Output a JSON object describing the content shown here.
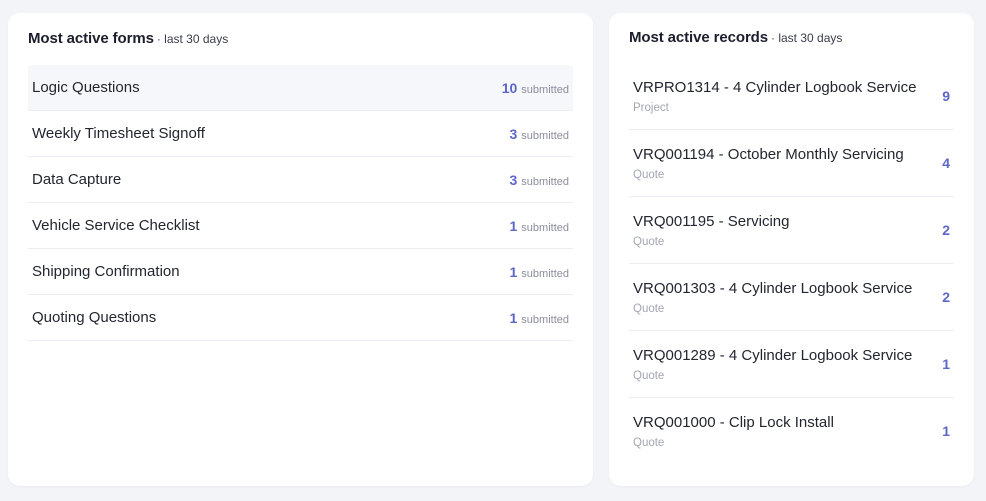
{
  "forms_card": {
    "title": "Most active forms",
    "subtitle": "· last 30 days",
    "submitted_label": "submitted",
    "items": [
      {
        "name": "Logic Questions",
        "count": "10"
      },
      {
        "name": "Weekly Timesheet Signoff",
        "count": "3"
      },
      {
        "name": "Data Capture",
        "count": "3"
      },
      {
        "name": "Vehicle Service Checklist",
        "count": "1"
      },
      {
        "name": "Shipping Confirmation",
        "count": "1"
      },
      {
        "name": "Quoting Questions",
        "count": "1"
      }
    ]
  },
  "records_card": {
    "title": "Most active records",
    "subtitle": "· last 30 days",
    "items": [
      {
        "name": "VRPRO1314 - 4 Cylinder Logbook Service",
        "type": "Project",
        "count": "9"
      },
      {
        "name": "VRQ001194 - October Monthly Servicing",
        "type": "Quote",
        "count": "4"
      },
      {
        "name": "VRQ001195 - Servicing",
        "type": "Quote",
        "count": "2"
      },
      {
        "name": "VRQ001303 - 4 Cylinder Logbook Service",
        "type": "Quote",
        "count": "2"
      },
      {
        "name": "VRQ001289 - 4 Cylinder Logbook Service",
        "type": "Quote",
        "count": "1"
      },
      {
        "name": "VRQ001000 - Clip Lock Install",
        "type": "Quote",
        "count": "1"
      }
    ]
  },
  "colors": {
    "accent": "#5c67c7",
    "background": "#f3f4f8",
    "card": "#ffffff",
    "muted": "#a3a7b3"
  }
}
